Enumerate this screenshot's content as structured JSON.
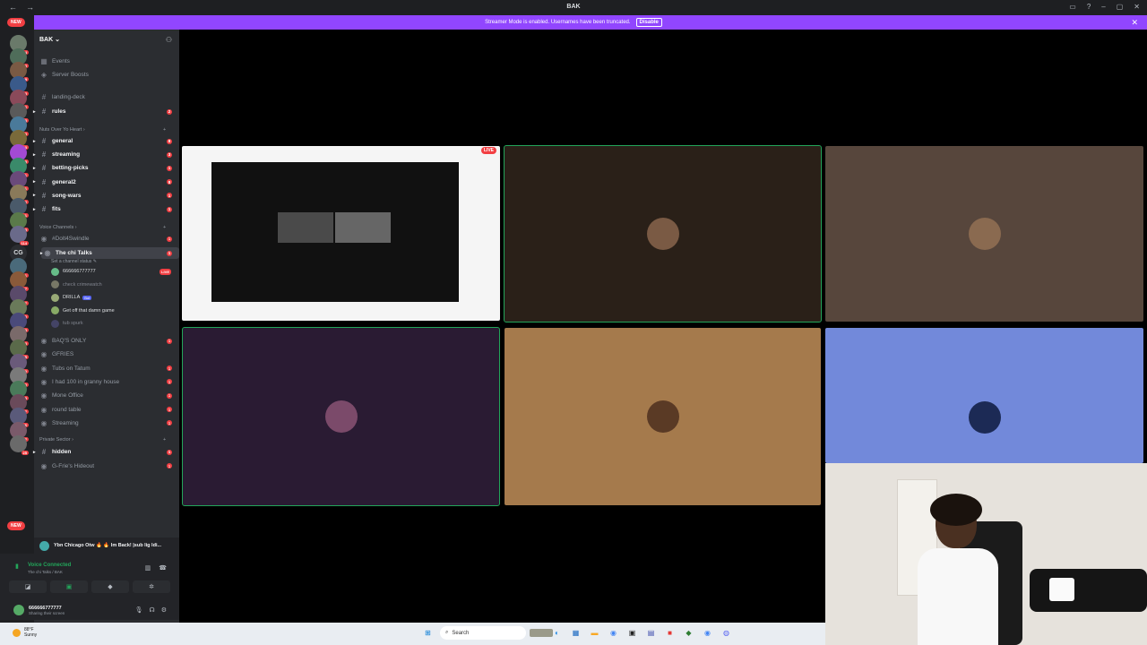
{
  "titlebar": {
    "title": "BAK"
  },
  "banner": {
    "text": "Streamer Mode is enabled. Usernames have been truncated.",
    "button": "Disable"
  },
  "rail": {
    "new_top": "NEW",
    "new_bottom": "NEW",
    "badges": [
      "734",
      "3",
      "8",
      "933",
      "2",
      "123",
      "13",
      "203",
      "5",
      "211",
      "541",
      "2",
      "181",
      "3",
      "114",
      "8",
      "1",
      "37",
      "7",
      "510",
      "173",
      "3",
      "185",
      "482",
      "20",
      "5",
      "37",
      "46",
      "27",
      "25"
    ],
    "text_server": "CG"
  },
  "sidebar": {
    "server_name": "BAK ⌄",
    "events": "Events",
    "boosts": "Server Boosts",
    "channels_top": [
      {
        "name": "landing-deck",
        "unread": false,
        "badge": ""
      },
      {
        "name": "rules",
        "unread": true,
        "badge": "2"
      }
    ],
    "cat_nuts": "Nuts Over Yo Heart",
    "channels_nuts": [
      {
        "name": "general",
        "badge": "8"
      },
      {
        "name": "streaming",
        "badge": "3"
      },
      {
        "name": "betting-picks",
        "badge": "1"
      },
      {
        "name": "general2",
        "badge": "8"
      },
      {
        "name": "song-wars",
        "badge": "1"
      },
      {
        "name": "fits",
        "badge": "1"
      }
    ],
    "cat_voice": "Voice Channels",
    "voice_top": [
      {
        "name": "#Dolt4Swindle",
        "badge": "1"
      }
    ],
    "active_vc": {
      "name": "The chi Talks",
      "badge": "1",
      "status": "Set a channel status ✎"
    },
    "members": [
      {
        "name": "666666777777",
        "live": "LIVE",
        "bot": "",
        "dim": false
      },
      {
        "name": "check crimewatch",
        "live": "",
        "bot": "",
        "dim": true
      },
      {
        "name": "DRILLA",
        "live": "",
        "bot": "Bot",
        "dim": false
      },
      {
        "name": "Get off that damn game",
        "live": "",
        "bot": "",
        "dim": false
      },
      {
        "name": "tub spurk",
        "live": "",
        "bot": "",
        "dim": true
      }
    ],
    "voice_rest": [
      {
        "name": "BAQ'S ONLY",
        "badge": "1"
      },
      {
        "name": "GFRIES",
        "badge": ""
      },
      {
        "name": "Tubs on Tatum",
        "badge": "1"
      },
      {
        "name": "I had 100 in granny house",
        "badge": "1"
      },
      {
        "name": "Mone Office",
        "badge": "1"
      },
      {
        "name": "round table",
        "badge": "1"
      },
      {
        "name": "Streaming",
        "badge": "1"
      }
    ],
    "cat_private": "Private Sector",
    "private": [
      {
        "name": "hidden",
        "badge": "1"
      },
      {
        "name": "G-Frie's Hideout",
        "badge": "1"
      }
    ]
  },
  "activity": {
    "text": "Ybn Chicago Otw 🔥 🔥 Im Back! |sub lig ldi..."
  },
  "voice": {
    "status": "Voice Connected",
    "channel": "The chi Talks / BAK"
  },
  "user": {
    "name": "666666777777",
    "status": "Sharing their screen"
  },
  "stage": {
    "live": "LIVE"
  },
  "taskbar": {
    "temp": "88°F",
    "cond": "Sunny",
    "search": "Search"
  },
  "colors": {
    "accent": "#9146ff",
    "speaking": "#23a55a",
    "danger": "#f23f43",
    "tile_brown": "#2a2018",
    "tile_mauve": "#57463c",
    "tile_purple": "#2a1b33",
    "tile_tan": "#a57a4c",
    "tile_blue": "#7289da"
  }
}
